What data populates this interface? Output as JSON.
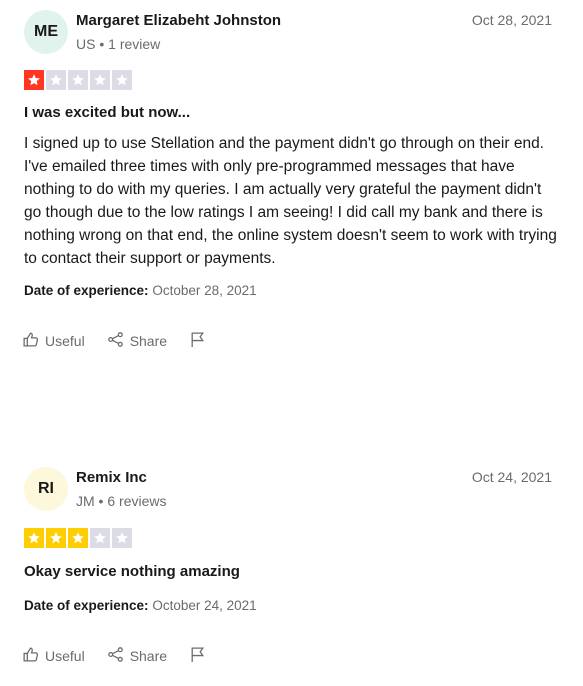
{
  "reviews": [
    {
      "initials": "ME",
      "avatar_color": "#e0f3ec",
      "name": "Margaret Elizabeht Johnston",
      "country": "US",
      "review_count": "1 review",
      "date": "Oct 28, 2021",
      "rating": 1,
      "star_color": "#ff3722",
      "title": "I was excited but now...",
      "body": "I signed up to use Stellation and the payment didn't go through on their end. I've emailed three times with only pre-programmed messages that have nothing to do with my queries. I am actually very grateful the payment didn't go though due to the low ratings I am seeing! I did call my bank and there is nothing wrong on that end, the online system doesn't seem to work with trying to contact their support or payments.",
      "experience_label": "Date of experience:",
      "experience_date": "October 28, 2021",
      "useful_label": "Useful",
      "share_label": "Share"
    },
    {
      "initials": "RI",
      "avatar_color": "#fdf7dc",
      "name": "Remix Inc",
      "country": "JM",
      "review_count": "6 reviews",
      "date": "Oct 24, 2021",
      "rating": 3,
      "star_color": "#ffce00",
      "title": "Okay service nothing amazing",
      "body": "",
      "experience_label": "Date of experience:",
      "experience_date": "October 24, 2021",
      "useful_label": "Useful",
      "share_label": "Share"
    }
  ],
  "empty_star_color": "#dcdce6"
}
